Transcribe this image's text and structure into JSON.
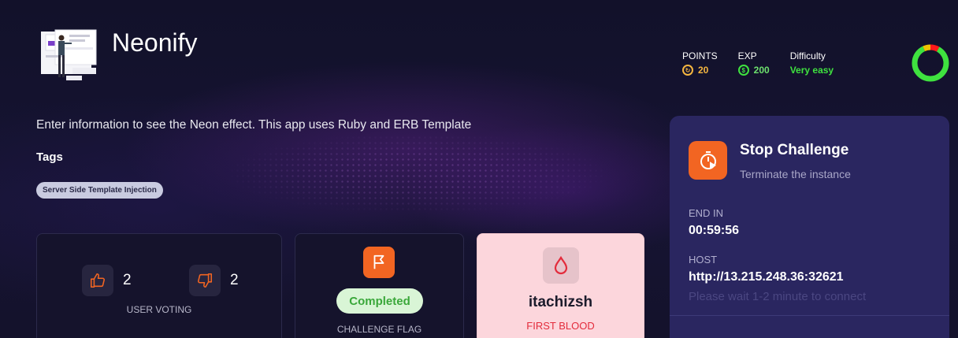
{
  "app": {
    "title": "Neonify"
  },
  "stats": {
    "points_label": "POINTS",
    "points_value": "20",
    "exp_label": "EXP",
    "exp_value": "200",
    "difficulty_label": "Difficulty",
    "difficulty_value": "Very easy"
  },
  "difficulty_meter": {
    "green_fraction": 0.85,
    "red_fraction": 0.08,
    "yellow_fraction": 0.07
  },
  "description": "Enter information to see the Neon effect. This app uses Ruby and ERB Template",
  "tags": {
    "heading": "Tags",
    "items": [
      "Server Side Template Injection"
    ]
  },
  "voting": {
    "up_count": "2",
    "down_count": "2",
    "caption": "USER VOTING"
  },
  "flag": {
    "status": "Completed",
    "caption": "CHALLENGE FLAG"
  },
  "first_blood": {
    "user": "itachizsh",
    "caption": "FIRST BLOOD"
  },
  "panel": {
    "title": "Stop Challenge",
    "subtitle": "Terminate the instance",
    "end_label": "END IN",
    "end_value": "00:59:56",
    "host_label": "HOST",
    "host_value": "http://13.215.248.36:32621",
    "wait_note": "Please wait 1-2 minute to connect"
  },
  "colors": {
    "accent": "#f26522",
    "points": "#f5b640",
    "exp": "#3fe23f",
    "panel": "#2a2660"
  }
}
